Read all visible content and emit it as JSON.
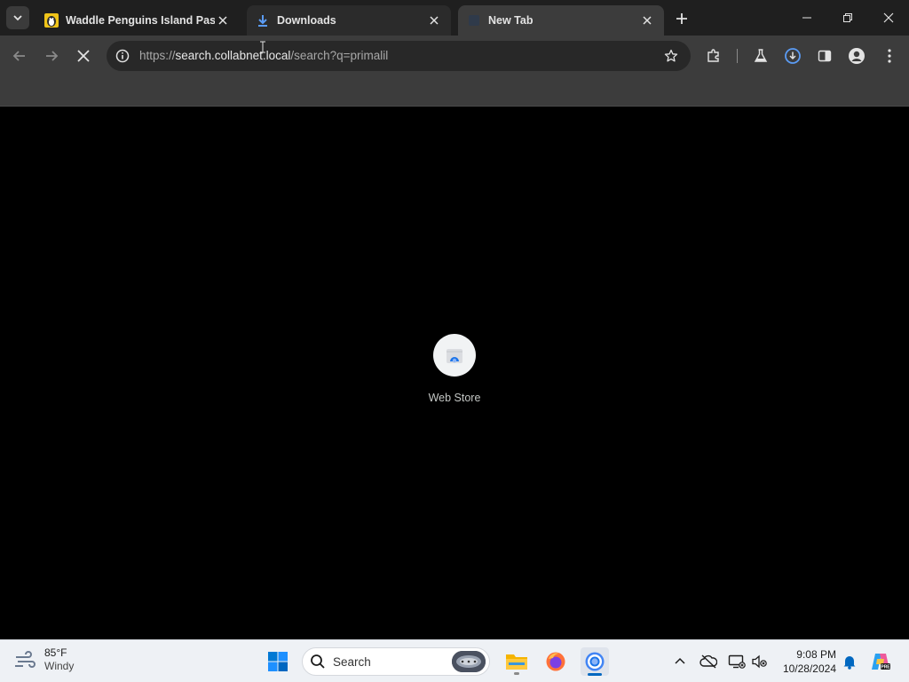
{
  "browser": {
    "tabs": [
      {
        "title": "Waddle Penguins Island Passport",
        "favicon": "penguin-favicon",
        "state": "inactive"
      },
      {
        "title": "Downloads",
        "favicon": "download-icon",
        "state": "inactive"
      },
      {
        "title": "New Tab",
        "favicon": "blank-favicon",
        "state": "active"
      }
    ],
    "address_bar": {
      "scheme": "https://",
      "host": "search.collabnet.local",
      "path": "/search?q=primalil"
    },
    "loading": true
  },
  "new_tab_page": {
    "shortcuts": [
      {
        "label": "Web Store",
        "icon": "web-store-icon"
      }
    ]
  },
  "taskbar": {
    "weather": {
      "temperature": "85°F",
      "condition": "Windy"
    },
    "search_placeholder": "Search",
    "pinned_apps": [
      "start-icon",
      "file-explorer-icon",
      "firefox-icon",
      "chrome-icon"
    ],
    "clock": {
      "time": "9:08 PM",
      "date": "10/28/2024"
    }
  },
  "colors": {
    "titlebar": "#1f1f1f",
    "toolbar": "#3c3c3c",
    "omnibox": "#282828",
    "page_background": "#000000",
    "taskbar": "#eef1f5",
    "accent": "#0067c0"
  }
}
